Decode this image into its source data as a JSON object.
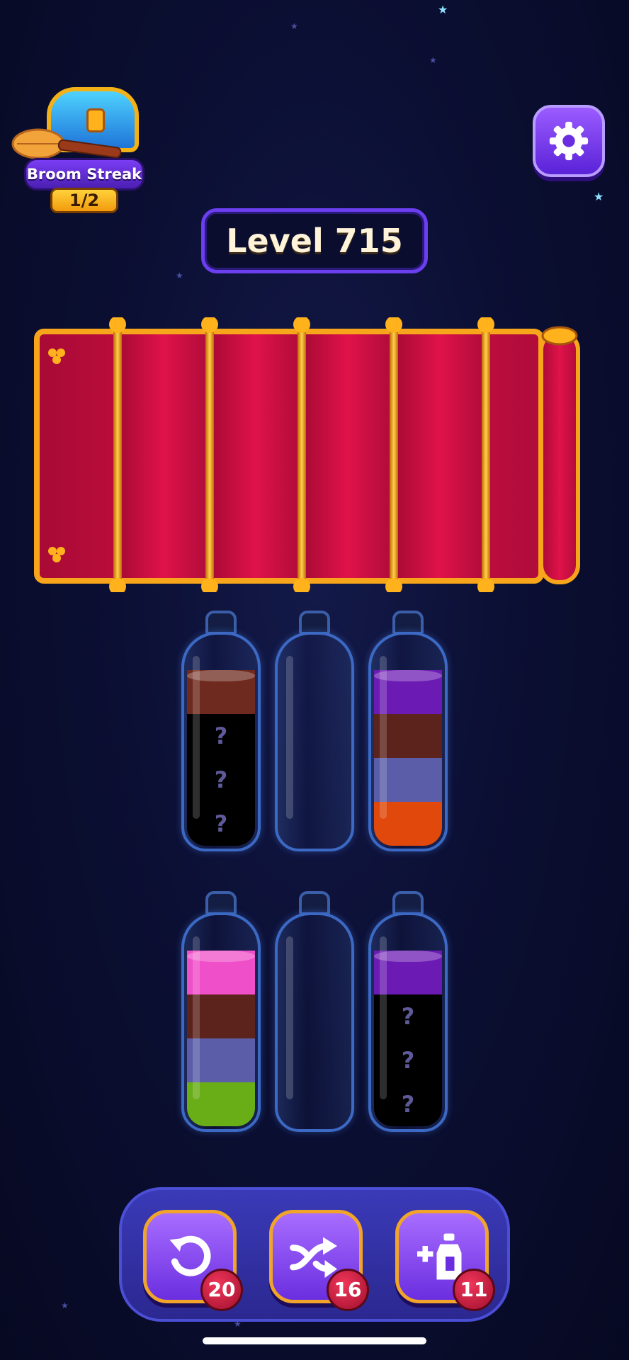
{
  "streak": {
    "title": "Broom Streak",
    "progress": "1/2"
  },
  "level": {
    "label": "Level 715"
  },
  "bottles": [
    {
      "layers": [
        {
          "color": "#000000",
          "hidden": true,
          "mark": "?"
        },
        {
          "color": "#000000",
          "hidden": true,
          "mark": "?"
        },
        {
          "color": "#000000",
          "hidden": true,
          "mark": "?"
        },
        {
          "color": "#6e2a1e",
          "hidden": false,
          "mark": ""
        }
      ]
    },
    {
      "layers": []
    },
    {
      "layers": [
        {
          "color": "#e0480c",
          "hidden": false,
          "mark": ""
        },
        {
          "color": "#5b5da8",
          "hidden": false,
          "mark": ""
        },
        {
          "color": "#5c231c",
          "hidden": false,
          "mark": ""
        },
        {
          "color": "#6b1bb3",
          "hidden": false,
          "mark": ""
        }
      ]
    },
    {
      "layers": [
        {
          "color": "#6aae17",
          "hidden": false,
          "mark": ""
        },
        {
          "color": "#5b5da8",
          "hidden": false,
          "mark": ""
        },
        {
          "color": "#5c231c",
          "hidden": false,
          "mark": ""
        },
        {
          "color": "#ef4fc8",
          "hidden": false,
          "mark": ""
        }
      ]
    },
    {
      "layers": []
    },
    {
      "layers": [
        {
          "color": "#000000",
          "hidden": true,
          "mark": "?"
        },
        {
          "color": "#000000",
          "hidden": true,
          "mark": "?"
        },
        {
          "color": "#000000",
          "hidden": true,
          "mark": "?"
        },
        {
          "color": "#6b1bb3",
          "hidden": false,
          "mark": ""
        }
      ]
    }
  ],
  "tools": [
    {
      "icon": "undo-icon",
      "count": "20"
    },
    {
      "icon": "shuffle-icon",
      "count": "16"
    },
    {
      "icon": "add-bottle-icon",
      "count": "11"
    }
  ]
}
